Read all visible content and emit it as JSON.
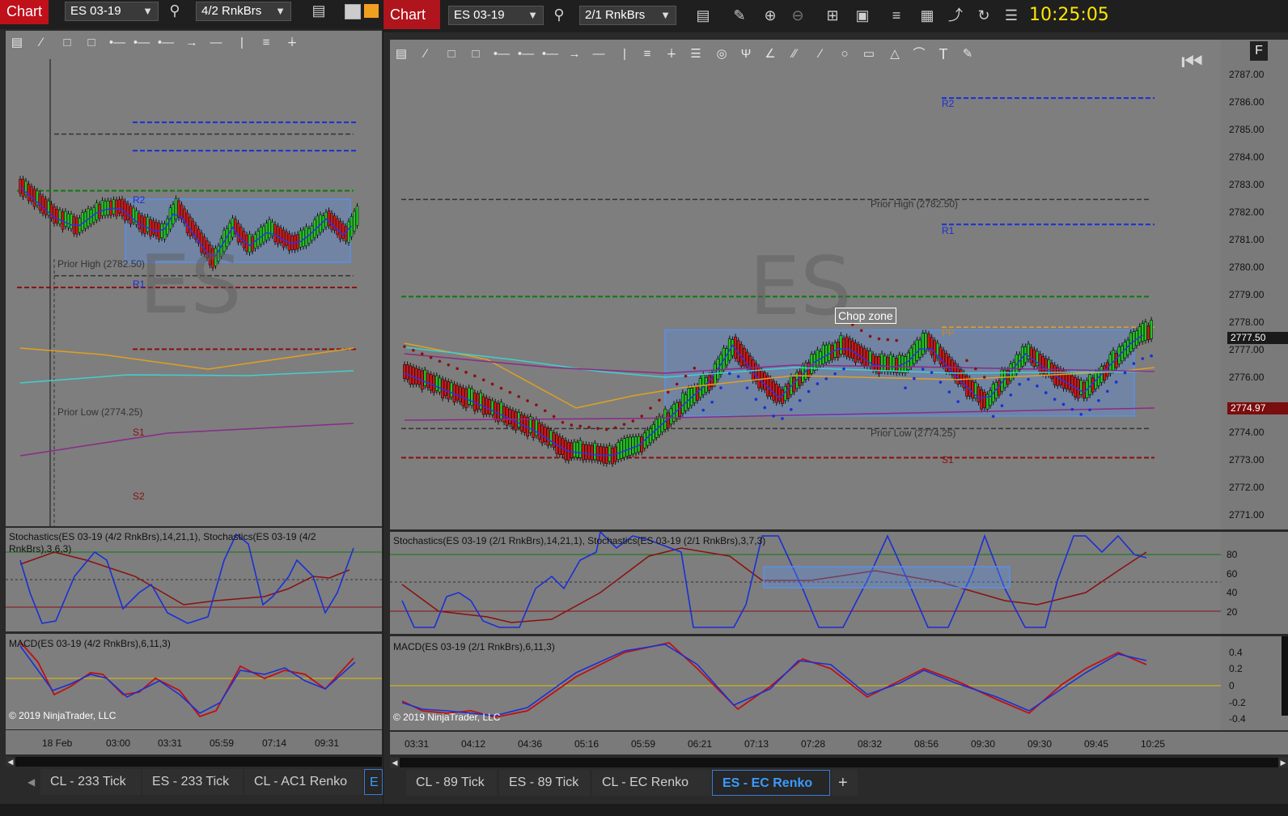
{
  "left_window": {
    "chart_label": "Chart",
    "instrument": "ES 03-19",
    "bar_type": "4/2 RnkBrs",
    "watermark": "ES",
    "levels": {
      "r2": "R2",
      "r1": "R1",
      "s1": "S1",
      "s2": "S2",
      "prior_high": "Prior High (2782.50)",
      "prior_low": "Prior Low (2774.25)"
    },
    "stoch_title": "Stochastics(ES 03-19 (4/2 RnkBrs),14,21,1), Stochastics(ES 03-19 (4/2 RnkBrs),3,6,3)",
    "macd_title": "MACD(ES 03-19 (4/2 RnkBrs),6,11,3)",
    "copyright": "© 2019 NinjaTrader, LLC",
    "time_labels": [
      "18 Feb",
      "03:00",
      "03:31",
      "05:59",
      "07:14",
      "09:31"
    ],
    "tabs": [
      "CL - 233 Tick",
      "ES - 233 Tick",
      "CL - AC1 Renko",
      "E"
    ]
  },
  "right_window": {
    "chart_label": "Chart",
    "instrument": "ES 03-19",
    "bar_type": "2/1 RnkBrs",
    "clock": "10:25:05",
    "watermark": "ES",
    "chop_zone_label": "Chop zone",
    "levels": {
      "r2": "R2",
      "r1": "R1",
      "pp": "PP",
      "s1": "S1",
      "prior_high": "Prior High (2782.50)",
      "prior_low": "Prior Low (2774.25)"
    },
    "price_axis": [
      "2787.00",
      "2786.00",
      "2785.00",
      "2784.00",
      "2783.00",
      "2782.00",
      "2781.00",
      "2780.00",
      "2779.00",
      "2778.00",
      "2777.00",
      "2776.00",
      "2774.00",
      "2773.00",
      "2772.00",
      "2771.00"
    ],
    "last_price": "2777.50",
    "marker_price": "2774.97",
    "stoch_title": "Stochastics(ES 03-19 (2/1 RnkBrs),14,21,1), Stochastics(ES 03-19 (2/1 RnkBrs),3,7,3)",
    "stoch_axis": [
      "80",
      "60",
      "40",
      "20"
    ],
    "macd_title": "MACD(ES 03-19 (2/1 RnkBrs),6,11,3)",
    "macd_axis": [
      "0.4",
      "0.2",
      "0",
      "-0.2",
      "-0.4"
    ],
    "copyright": "© 2019 NinjaTrader, LLC",
    "time_labels": [
      "03:31",
      "04:12",
      "04:36",
      "05:16",
      "05:59",
      "06:21",
      "07:13",
      "07:28",
      "08:32",
      "08:56",
      "09:30",
      "09:30",
      "09:45",
      "10:25"
    ],
    "tabs": [
      "CL - 89 Tick",
      "ES - 89 Tick",
      "CL - EC Renko",
      "ES - EC Renko"
    ],
    "add_tab": "+",
    "corner_label": "F"
  },
  "colors": {
    "up": "#22c422",
    "down": "#d01818",
    "pivot_blue": "#1a2fd6",
    "pivot_red": "#8a1010",
    "green_level": "#0d7a0d",
    "zone": "#5a8fe8",
    "clock": "#ffe600",
    "chart_label_bg": "#c0101a"
  },
  "icons": [
    "search-icon",
    "bars-icon",
    "pencil-icon",
    "zoom-in-icon",
    "zoom-out-icon",
    "crosshair-icon",
    "data-box-icon",
    "indicator-icon",
    "strategy-icon",
    "drawing-icon",
    "reload-icon",
    "properties-icon"
  ]
}
